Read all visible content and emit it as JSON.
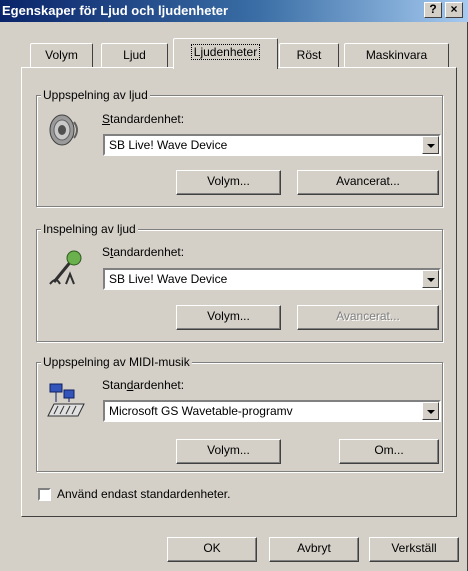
{
  "window": {
    "title": "Egenskaper för Ljud och ljudenheter",
    "help_button": "?",
    "close_button": "×"
  },
  "tabs": [
    {
      "label": "Volym",
      "active": false
    },
    {
      "label": "Ljud",
      "active": false
    },
    {
      "label": "Ljudenheter",
      "active": true
    },
    {
      "label": "Röst",
      "active": false
    },
    {
      "label": "Maskinvara",
      "active": false
    }
  ],
  "playback": {
    "group_title": "Uppspelning av ljud",
    "device_label": "Standardenhet:",
    "device_value": "SB Live! Wave Device",
    "volume_button": "Volym...",
    "advanced_button": "Avancerat...",
    "icon": "speaker-icon"
  },
  "recording": {
    "group_title": "Inspelning av ljud",
    "device_label": "Standardenhet:",
    "device_value": "SB Live! Wave Device",
    "volume_button": "Volym...",
    "advanced_button": "Avancerat...",
    "advanced_enabled": false,
    "icon": "microphone-icon"
  },
  "midi": {
    "group_title": "Uppspelning av MIDI-musik",
    "device_label": "Standardenhet:",
    "device_value": "Microsoft GS Wavetable-programv",
    "volume_button": "Volym...",
    "about_button": "Om...",
    "icon": "midi-keyboard-icon"
  },
  "use_default_only": {
    "label": "Använd endast standardenheter.",
    "checked": false
  },
  "footer": {
    "ok": "OK",
    "cancel": "Avbryt",
    "apply": "Verkställ"
  }
}
